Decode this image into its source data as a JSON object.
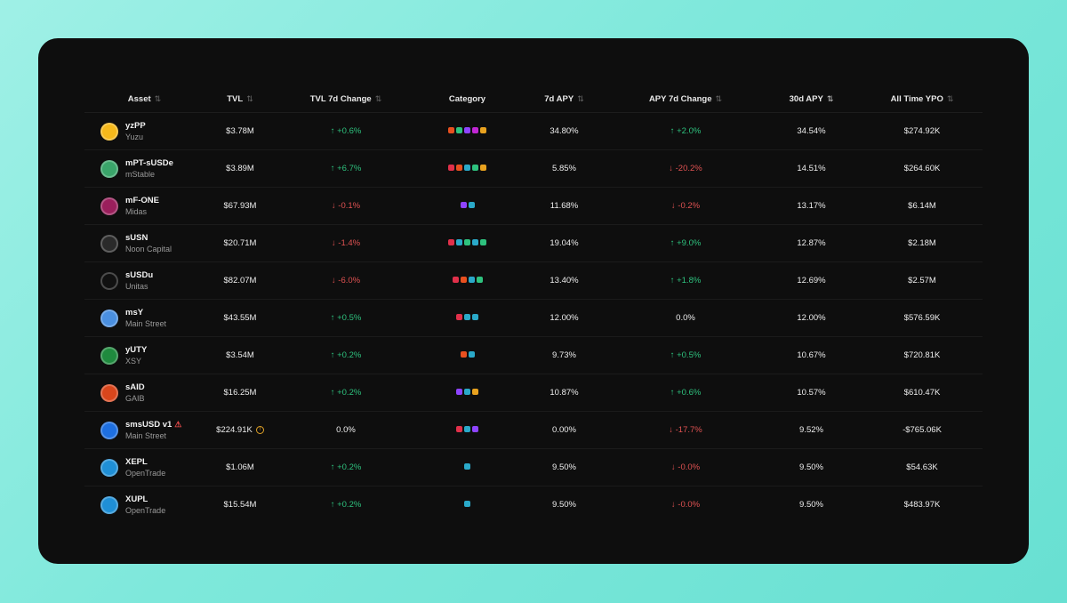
{
  "colors": {
    "up": "#2ec27e",
    "down": "#e05252",
    "card_bg": "#0e0e0e"
  },
  "headers": {
    "asset": "Asset",
    "tvl": "TVL",
    "tvl_change": "TVL 7d Change",
    "category": "Category",
    "apy7": "7d APY",
    "apy_change": "APY 7d Change",
    "apy30": "30d APY",
    "ypo": "All Time YPO"
  },
  "rows": [
    {
      "symbol": "yzPP",
      "project": "Yuzu",
      "tvl": "$3.78M",
      "tvl_change": "↑ +0.6%",
      "tvl_dir": "up",
      "categories": [
        "#e8501f",
        "#2ec27e",
        "#8e44ff",
        "#c026d3",
        "#e8a21f"
      ],
      "apy7": "34.80%",
      "apy_change": "↑ +2.0%",
      "apy_dir": "up",
      "apy30": "34.54%",
      "ypo": "$274.92K",
      "logo_color": "#f5b81b",
      "logo_icon": "yuzu-logo-icon"
    },
    {
      "symbol": "mPT-sUSDe",
      "project": "mStable",
      "tvl": "$3.89M",
      "tvl_change": "↑ +6.7%",
      "tvl_dir": "up",
      "categories": [
        "#e0304a",
        "#e8501f",
        "#2aa9c9",
        "#2ec27e",
        "#e8a21f"
      ],
      "apy7": "5.85%",
      "apy_change": "↓ -20.2%",
      "apy_dir": "down",
      "apy30": "14.51%",
      "ypo": "$264.60K",
      "logo_color": "#3aa56a",
      "logo_icon": "mstable-logo-icon"
    },
    {
      "symbol": "mF-ONE",
      "project": "Midas",
      "tvl": "$67.93M",
      "tvl_change": "↓ -0.1%",
      "tvl_dir": "down",
      "categories": [
        "#8e44ff",
        "#2aa9c9"
      ],
      "apy7": "11.68%",
      "apy_change": "↓ -0.2%",
      "apy_dir": "down",
      "apy30": "13.17%",
      "ypo": "$6.14M",
      "logo_color": "#9a1f5c",
      "logo_icon": "midas-logo-icon"
    },
    {
      "symbol": "sUSN",
      "project": "Noon Capital",
      "tvl": "$20.71M",
      "tvl_change": "↓ -1.4%",
      "tvl_dir": "down",
      "categories": [
        "#e0304a",
        "#2aa9c9",
        "#2ec27e",
        "#2aa9c9",
        "#2ec27e"
      ],
      "apy7": "19.04%",
      "apy_change": "↑ +9.0%",
      "apy_dir": "up",
      "apy30": "12.87%",
      "ypo": "$2.18M",
      "logo_color": "#2a2a2a",
      "logo_icon": "noon-logo-icon"
    },
    {
      "symbol": "sUSDu",
      "project": "Unitas",
      "tvl": "$82.07M",
      "tvl_change": "↓ -6.0%",
      "tvl_dir": "down",
      "categories": [
        "#e0304a",
        "#e8501f",
        "#2aa9c9",
        "#2ec27e"
      ],
      "apy7": "13.40%",
      "apy_change": "↑ +1.8%",
      "apy_dir": "up",
      "apy30": "12.69%",
      "ypo": "$2.57M",
      "logo_color": "#111111",
      "logo_icon": "unitas-logo-icon"
    },
    {
      "symbol": "msY",
      "project": "Main Street",
      "tvl": "$43.55M",
      "tvl_change": "↑ +0.5%",
      "tvl_dir": "up",
      "categories": [
        "#e0304a",
        "#2aa9c9",
        "#2aa9c9"
      ],
      "apy7": "12.00%",
      "apy_change": "0.0%",
      "apy_dir": "neutral",
      "apy30": "12.00%",
      "ypo": "$576.59K",
      "logo_color": "#4a8fe0",
      "logo_icon": "mainstreet-logo-icon"
    },
    {
      "symbol": "yUTY",
      "project": "XSY",
      "tvl": "$3.54M",
      "tvl_change": "↑ +0.2%",
      "tvl_dir": "up",
      "categories": [
        "#e8501f",
        "#2aa9c9"
      ],
      "apy7": "9.73%",
      "apy_change": "↑ +0.5%",
      "apy_dir": "up",
      "apy30": "10.67%",
      "ypo": "$720.81K",
      "logo_color": "#1f8a3e",
      "logo_icon": "xsy-logo-icon"
    },
    {
      "symbol": "sAID",
      "project": "GAIB",
      "tvl": "$16.25M",
      "tvl_change": "↑ +0.2%",
      "tvl_dir": "up",
      "categories": [
        "#8e44ff",
        "#2aa9c9",
        "#e8a21f"
      ],
      "apy7": "10.87%",
      "apy_change": "↑ +0.6%",
      "apy_dir": "up",
      "apy30": "10.57%",
      "ypo": "$610.47K",
      "logo_color": "#d9461c",
      "logo_icon": "gaib-logo-icon"
    },
    {
      "symbol": "smsUSD v1",
      "project": "Main Street",
      "tvl": "$224.91K",
      "tvl_change": "0.0%",
      "tvl_dir": "neutral",
      "categories": [
        "#e0304a",
        "#2aa9c9",
        "#8e44ff"
      ],
      "apy7": "0.00%",
      "apy_change": "↓ -17.7%",
      "apy_dir": "down",
      "apy30": "9.52%",
      "ypo": "-$765.06K",
      "logo_color": "#1e6fe0",
      "logo_icon": "mainstreet-logo-icon",
      "warning": "⚠",
      "tvl_info": "!"
    },
    {
      "symbol": "XEPL",
      "project": "OpenTrade",
      "tvl": "$1.06M",
      "tvl_change": "↑ +0.2%",
      "tvl_dir": "up",
      "categories": [
        "#2aa9c9"
      ],
      "apy7": "9.50%",
      "apy_change": "↓ -0.0%",
      "apy_dir": "down",
      "apy30": "9.50%",
      "ypo": "$54.63K",
      "logo_color": "#1f8fd6",
      "logo_icon": "opentrade-logo-icon"
    },
    {
      "symbol": "XUPL",
      "project": "OpenTrade",
      "tvl": "$15.54M",
      "tvl_change": "↑ +0.2%",
      "tvl_dir": "up",
      "categories": [
        "#2aa9c9"
      ],
      "apy7": "9.50%",
      "apy_change": "↓ -0.0%",
      "apy_dir": "down",
      "apy30": "9.50%",
      "ypo": "$483.97K",
      "logo_color": "#1f8fd6",
      "logo_icon": "opentrade-logo-icon"
    }
  ]
}
